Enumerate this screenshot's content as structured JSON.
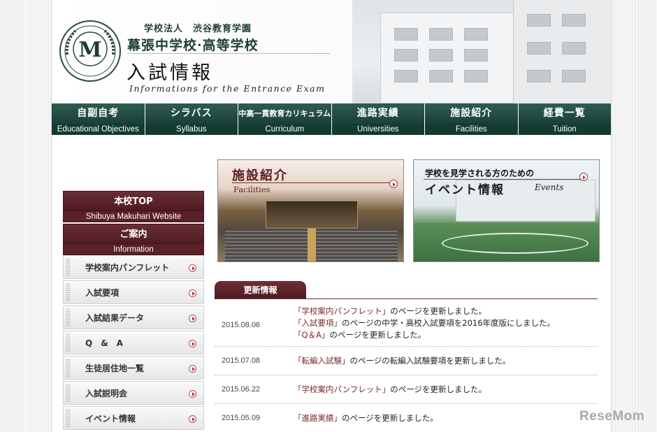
{
  "header": {
    "corporation": "学校法人　渋谷教育学園",
    "school": "幕張中学校·高等学校",
    "title": "入試情報",
    "subtitle": "Informations for the Entrance Exam",
    "logo_letter": "M"
  },
  "nav": [
    {
      "jp": "自副自考",
      "en": "Educational  Objectives"
    },
    {
      "jp": "シラバス",
      "en": "Syllabus"
    },
    {
      "jp": "中高一貫教育カリキュラム",
      "en": "Curriculum"
    },
    {
      "jp": "進路実績",
      "en": "Universities"
    },
    {
      "jp": "施設紹介",
      "en": "Facilities"
    },
    {
      "jp": "経費一覧",
      "en": "Tuition"
    }
  ],
  "sidebar": {
    "top": {
      "label": "本校TOP",
      "sub": "Shibuya Makuhari Website"
    },
    "info": {
      "label": "ご案内",
      "sub": "Information"
    },
    "items": [
      {
        "label": "学校案内パンフレット"
      },
      {
        "label": "入試要項"
      },
      {
        "label": "入試結果データ"
      },
      {
        "label": "Q　&　A"
      },
      {
        "label": "生徒居住地一覧"
      },
      {
        "label": "入試説明会"
      },
      {
        "label": "イベント情報"
      }
    ]
  },
  "banners": {
    "facilities": {
      "title": "施設紹介",
      "sub": "Facilities"
    },
    "events": {
      "pre": "学校を見学される方のための",
      "title": "イベント情報",
      "sub": "Events"
    }
  },
  "news": {
    "tab": "更新情報",
    "items": [
      {
        "date": "2015.08.06",
        "lines": [
          {
            "link": "「学校案内パンフレット」",
            "text": "のページを更新しました。"
          },
          {
            "link": "「入試要項」",
            "text": "のページの中学・高校入試要項を2016年度版にしました。"
          },
          {
            "link": "「Q＆A」",
            "text": "のページを更新しました。"
          }
        ]
      },
      {
        "date": "2015.07.08",
        "lines": [
          {
            "link": "「転編入試験」",
            "text": "のページの転編入試験要項を更新しました。"
          }
        ]
      },
      {
        "date": "2015.06.22",
        "lines": [
          {
            "link": "「学校案内パンフレット」",
            "text": "のページを更新しました。"
          }
        ]
      },
      {
        "date": "2015.05.09",
        "lines": [
          {
            "link": "「進路実績」",
            "text": "のページを更新しました。"
          }
        ]
      }
    ]
  },
  "watermark": "ReseMom"
}
